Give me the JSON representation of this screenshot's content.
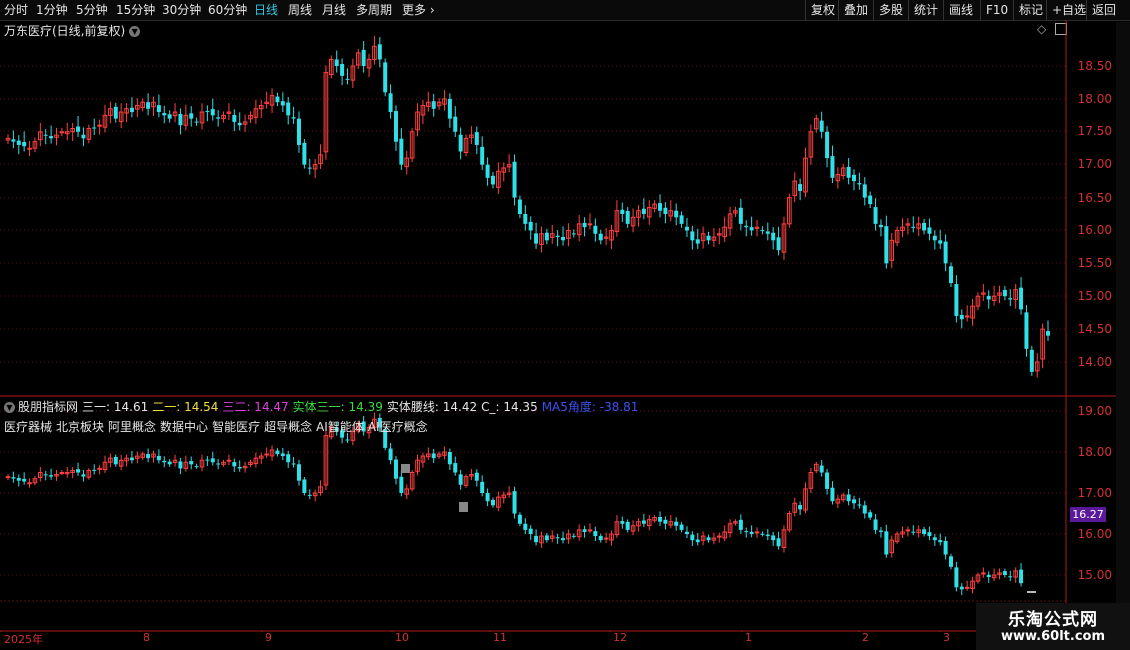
{
  "toolbar": {
    "periods": [
      "分时",
      "1分钟",
      "5分钟",
      "15分钟",
      "30分钟",
      "60分钟",
      "日线",
      "周线",
      "月线",
      "多周期",
      "更多"
    ],
    "active_period": "日线",
    "right_buttons": [
      "复权",
      "叠加",
      "多股",
      "统计",
      "画线",
      "F10",
      "标记",
      "+自选",
      "返回"
    ]
  },
  "main_chart": {
    "title": "万东医疗(日线,前复权)",
    "y_ticks": [
      "18.50",
      "18.00",
      "17.50",
      "17.00",
      "16.50",
      "16.00",
      "15.50",
      "15.00",
      "14.50",
      "14.00"
    ]
  },
  "indicator": {
    "name": "股朋指标网",
    "values": [
      {
        "label": "三一: 14.61",
        "color": "#e6e6e6"
      },
      {
        "label": "二一: 14.54",
        "color": "#f0e03c"
      },
      {
        "label": "三二: 14.47",
        "color": "#e040e0"
      },
      {
        "label": "实体三一: 14.39",
        "color": "#3cdc3c"
      },
      {
        "label": "实体腰线: 14.42",
        "color": "#e6e6e6"
      },
      {
        "label": "C_: 14.35",
        "color": "#e6e6e6"
      },
      {
        "label": "MA5角度: -38.81",
        "color": "#3c50f0"
      }
    ],
    "tags": [
      "医疗器械",
      "北京板块",
      "阿里概念",
      "数据中心",
      "智能医疗",
      "超导概念",
      "AI智能体",
      "AI医疗概念"
    ],
    "y_ticks": [
      "19.00",
      "18.00",
      "17.00",
      "16.00",
      "15.00"
    ],
    "current_price": "16.27"
  },
  "time_axis": {
    "labels": [
      "2025年",
      "8",
      "9",
      "10",
      "11",
      "12",
      "1",
      "2",
      "3"
    ]
  },
  "watermark": {
    "name": "乐淘公式网",
    "url": "www.60lt.com"
  },
  "colors": {
    "up": "#ff4040",
    "down": "#30e0e8",
    "grid": "#5a1010",
    "axis": "#d23232"
  },
  "chart_data": {
    "type": "candlestick",
    "series": [
      {
        "values": [
          17.4,
          17.35,
          17.3,
          17.28,
          17.25,
          17.35,
          17.5,
          17.45,
          17.4,
          17.45,
          17.5,
          17.5,
          17.55,
          17.5,
          17.4,
          17.55,
          17.55,
          17.6,
          17.75,
          17.85,
          17.7,
          17.8,
          17.85,
          17.8,
          17.9,
          17.95,
          17.85,
          17.95,
          17.8,
          17.75,
          17.7,
          17.8,
          17.6,
          17.75,
          17.7,
          17.65,
          17.8,
          17.8,
          17.75,
          17.7,
          17.75,
          17.8,
          17.65,
          17.6,
          17.65,
          17.75,
          17.85,
          17.9,
          17.95,
          18.05,
          17.95,
          17.9,
          17.75,
          17.7,
          17.3,
          17.0,
          16.95,
          17.0,
          17.15,
          18.4,
          18.6,
          18.5,
          18.35,
          18.3,
          18.5,
          18.7,
          18.5,
          18.6,
          18.8,
          18.6,
          18.1,
          17.8,
          17.35,
          17.0,
          17.1,
          17.5,
          17.8,
          17.9,
          17.95,
          17.85,
          17.95,
          18.0,
          17.7,
          17.5,
          17.2,
          17.4,
          17.45,
          17.3,
          17.0,
          16.8,
          16.7,
          16.9,
          16.95,
          17.0,
          16.5,
          16.25,
          16.1,
          16.0,
          15.8,
          15.95,
          15.85,
          15.95,
          15.9,
          15.85,
          16.0,
          15.95,
          16.1,
          16.05,
          16.1,
          15.95,
          15.85,
          15.9,
          16.0,
          16.3,
          16.25,
          16.1,
          16.2,
          16.3,
          16.25,
          16.35,
          16.4,
          16.3,
          16.25,
          16.3,
          16.2,
          16.1,
          16.0,
          15.85,
          15.8,
          15.95,
          15.85,
          15.9,
          15.95,
          16.05,
          16.25,
          16.3,
          16.1,
          16.05,
          16.0,
          16.05,
          16.0,
          15.95,
          15.85,
          15.7,
          16.1,
          16.5,
          16.75,
          16.6,
          17.1,
          17.5,
          17.7,
          17.5,
          17.1,
          16.8,
          16.85,
          16.95,
          16.8,
          16.75,
          16.7,
          16.5,
          16.4,
          16.1,
          16.05,
          15.5,
          15.85,
          16.0,
          16.05,
          16.1,
          16.05,
          16.1,
          16.0,
          15.95,
          15.85,
          15.8,
          15.5,
          15.2,
          14.7,
          14.65,
          14.7,
          14.85,
          15.0,
          15.05,
          14.95,
          15.0,
          15.05,
          15.0,
          14.95,
          15.1,
          14.8,
          14.2,
          13.85,
          14.0,
          14.5,
          14.4
        ]
      }
    ],
    "x_labels": [
      "2025年",
      "8",
      "9",
      "10",
      "11",
      "12",
      "1",
      "2",
      "3"
    ],
    "ylim": [
      13.7,
      18.95
    ]
  }
}
